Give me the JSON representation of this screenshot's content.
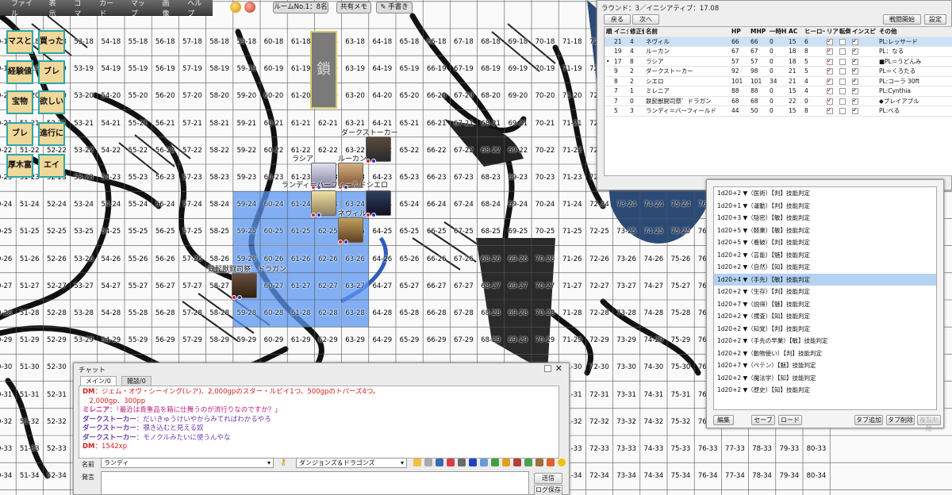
{
  "menu": [
    "ファイル",
    "表示",
    "コマ",
    "カード",
    "マップ",
    "画像",
    "ヘルプ"
  ],
  "room_label": "ルームNo.1：8名",
  "shared_memo": "共有メモ",
  "handout": "手書き",
  "cards": [
    "マスと",
    "買った",
    "経験値",
    "ブレ",
    "宝物",
    "欲しい",
    "ブレ",
    "進行に",
    "厚木富",
    "エイ"
  ],
  "lock_label": "鎖",
  "grid": {
    "cols": [
      "50",
      "51",
      "52",
      "53",
      "54",
      "55",
      "56",
      "57",
      "58",
      "59",
      "60",
      "61",
      "62",
      "63",
      "64",
      "65",
      "66",
      "67",
      "68",
      "69",
      "70",
      "71",
      "72",
      "73",
      "74",
      "75",
      "76",
      "77",
      "78",
      "79",
      "80"
    ],
    "rows": [
      "18",
      "19",
      "20",
      "21",
      "22",
      "23",
      "24",
      "25",
      "26",
      "27",
      "28",
      "29",
      "30",
      "31",
      "32",
      "33",
      "34",
      "35"
    ]
  },
  "tokens": [
    {
      "name": "ダークストーカー"
    },
    {
      "name": "ラシア"
    },
    {
      "name": "ルーカン"
    },
    {
      "name": "ランディ＝バーフィールド"
    },
    {
      "name": "シエロ"
    },
    {
      "name": "ネヴィル"
    },
    {
      "name": "鉄髭獣闘司祭゛ドラガン"
    }
  ],
  "initiative": {
    "title": "ラウンド：3／イニシアティブ：17.08",
    "btn_back": "戻る",
    "btn_next": "次へ",
    "btn_start": "戦闘開始",
    "btn_settings": "設定",
    "btn_change": "変更",
    "btn_delete": "削除",
    "headers": [
      "順",
      "イニシ",
      "修正値",
      "名前",
      "HP",
      "MHP",
      "一時HP",
      "AC",
      "ヒーロー",
      "リア",
      "転倒",
      "インスピ",
      "その他"
    ],
    "rows": [
      {
        "mark": "",
        "init": "21",
        "mod": "4",
        "name": "ネヴィル",
        "hp": "66",
        "mhp": "66",
        "tmp": "0",
        "ac": "15",
        "hero": "6",
        "r": true,
        "f": false,
        "ins": true,
        "other": "PL:レッサード"
      },
      {
        "mark": "",
        "init": "19",
        "mod": "4",
        "name": "ルーカン",
        "hp": "67",
        "mhp": "67",
        "tmp": "0",
        "ac": "18",
        "hero": "8",
        "r": true,
        "f": false,
        "ins": true,
        "other": "PL：なる"
      },
      {
        "mark": "•",
        "init": "17",
        "mod": "8",
        "name": "ラシア",
        "hp": "57",
        "mhp": "57",
        "tmp": "0",
        "ac": "18",
        "hero": "5",
        "r": true,
        "f": false,
        "ins": true,
        "other": "■PL＝うどんみ"
      },
      {
        "mark": "",
        "init": "9",
        "mod": "2",
        "name": "ダークストーカー",
        "hp": "92",
        "mhp": "98",
        "tmp": "0",
        "ac": "21",
        "hero": "5",
        "r": true,
        "f": false,
        "ins": true,
        "other": "PL＝くろたる"
      },
      {
        "mark": "",
        "init": "8",
        "mod": "2",
        "name": "シエロ",
        "hp": "101",
        "mhp": "101",
        "tmp": "34",
        "ac": "21",
        "hero": "4",
        "r": true,
        "f": false,
        "ins": true,
        "other": "PL:コーラ 30ft"
      },
      {
        "mark": "",
        "init": "7",
        "mod": "1",
        "name": "ミレニア",
        "hp": "88",
        "mhp": "88",
        "tmp": "0",
        "ac": "15",
        "hero": "4",
        "r": true,
        "f": false,
        "ins": true,
        "other": "PL:Cynthia"
      },
      {
        "mark": "",
        "init": "7",
        "mod": "0",
        "name": "鉄髭獣闘司祭゛ドラガン",
        "hp": "68",
        "mhp": "68",
        "tmp": "0",
        "ac": "22",
        "hero": "0",
        "r": true,
        "f": false,
        "ins": true,
        "other": "◆ブレイアブル"
      },
      {
        "mark": "",
        "init": "5",
        "mod": "3",
        "name": "ランディ＝バーフィールド",
        "hp": "44",
        "mhp": "50",
        "tmp": "0",
        "ac": "15",
        "hero": "8",
        "r": true,
        "f": false,
        "ins": true,
        "other": "PL:べる"
      }
    ]
  },
  "dice": {
    "rows": [
      "1d20+2 ▼（医術）【判】技能判定",
      "1d20+1 ▼（運動）【判】技能判定",
      "1d20+3 ▼（隠密）【敏】技能判定",
      "1d20+5 ▼（軽業）【敏】技能判定",
      "1d20+5 ▼（看破）【判】技能判定",
      "1d20+2 ▼（芸能）【魅】技能判定",
      "1d20+2 ▼（自然）【知】技能判定",
      "1d20+4 ▼（手先）【敏】技能判定",
      "1d20+2 ▼（生存）【判】技能判定",
      "1d20+7 ▼（説得）【魅】技能判定",
      "1d20+2 ▼（捜査）【知】技能判定",
      "1d20+2 ▼（知覚）【判】技能判定",
      "1d20+2 ▼（手先の早業）【敏】技能判定",
      "1d20+2 ▼（動物使い）【判】技能判定",
      "1d20+7 ▼（ペテン）【魅】技能判定",
      "1d20+2 ▼（魔法学）【知】技能判定",
      "1d20+2 ▼（歴史）【知】技能判定"
    ],
    "btn_edit": "編集",
    "btn_save": "セーブ",
    "btn_load": "ロード",
    "btn_addtab": "タブ追加",
    "btn_deltab": "タブ削除",
    "btn_dup": "複製削除"
  },
  "chat": {
    "title": "チャット",
    "tabs": [
      "メイン/0",
      "雑談/0"
    ],
    "messages": [
      {
        "who": "DM",
        "sep": "：",
        "text": "ジェム・オヴ・シーイング(レア)、2,000gpのスター・ルビイ1つ、500gpのトパーズ4つ。",
        "color": "#d42020"
      },
      {
        "who": "",
        "sep": "",
        "text": "　2,000gp、300pp",
        "color": "#d42020"
      },
      {
        "who": "ミレニア",
        "sep": "：",
        "text": "「最近は貴重品を箱に仕舞うのが流行りなのですか？」",
        "color": "#c02080"
      },
      {
        "who": "ダークストーカー",
        "sep": "：",
        "text": "だいきゅうけいやからみてればわかるやろ",
        "color": "#6a3aa8"
      },
      {
        "who": "ダークストーカー",
        "sep": "：",
        "text": "覗き込むと見える奴",
        "color": "#6a3aa8"
      },
      {
        "who": "ダークストーカー",
        "sep": "：",
        "text": "モノクルみたいに使うんやな",
        "color": "#6a3aa8"
      },
      {
        "who": "DM",
        "sep": "：",
        "text": "1542xp",
        "color": "#d42020"
      }
    ],
    "name_label": "名前",
    "name_value": "ランディ",
    "system_value": "ダンジョンズ＆ドラゴンズ",
    "say_label": "発言",
    "btn_send": "送信",
    "btn_log": "ログ保存"
  }
}
